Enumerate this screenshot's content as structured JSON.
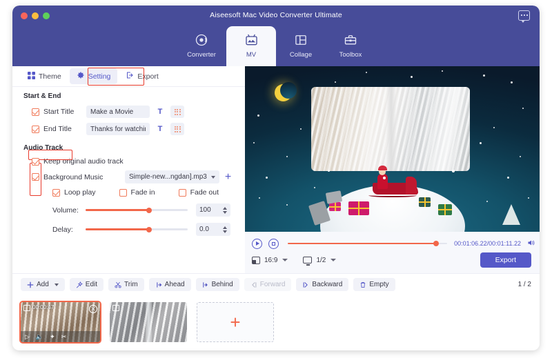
{
  "window": {
    "title": "Aiseesoft Mac Video Converter Ultimate",
    "chat_icon": "chat-bubble-icon",
    "traffic_lights": [
      "close",
      "minimize",
      "maximize"
    ]
  },
  "nav": {
    "tabs": [
      {
        "label": "Converter",
        "icon": "converter-icon",
        "active": false
      },
      {
        "label": "MV",
        "icon": "mv-icon",
        "active": true
      },
      {
        "label": "Collage",
        "icon": "collage-icon",
        "active": false
      },
      {
        "label": "Toolbox",
        "icon": "toolbox-icon",
        "active": false
      }
    ]
  },
  "left_panel": {
    "subtabs": [
      {
        "label": "Theme",
        "icon": "grid-icon",
        "active": false
      },
      {
        "label": "Setting",
        "icon": "gear-icon",
        "active": true
      },
      {
        "label": "Export",
        "icon": "export-icon",
        "active": false
      }
    ],
    "start_end": {
      "section_title": "Start & End",
      "start_title": {
        "label": "Start Title",
        "value": "Make a Movie",
        "checked": true,
        "text_button": "T",
        "style_button": "dots-grid-icon"
      },
      "end_title": {
        "label": "End Title",
        "value": "Thanks for watching",
        "checked": true,
        "text_button": "T",
        "style_button": "dots-grid-icon"
      }
    },
    "audio_track": {
      "section_title": "Audio Track",
      "keep_original": {
        "label": "Keep original audio track",
        "checked": true
      },
      "background_music": {
        "label": "Background Music",
        "checked": true
      },
      "music_file": "Simple-new...ngdan].mp3",
      "add_music_button": "+",
      "options": [
        {
          "label": "Loop play",
          "checked": true
        },
        {
          "label": "Fade in",
          "checked": false
        },
        {
          "label": "Fade out",
          "checked": false
        }
      ],
      "volume": {
        "label": "Volume:",
        "value": "100",
        "percent": 62
      },
      "delay": {
        "label": "Delay:",
        "value": "0.0",
        "percent": 62
      }
    }
  },
  "preview": {
    "scene": "christmas-snowglobe-santa-sleigh",
    "player": {
      "play_button": "play-icon",
      "stop_button": "stop-icon",
      "current_time": "00:01:06.22",
      "total_time": "00:01:11.22",
      "time_display": "00:01:06.22/00:01:11.22",
      "progress_percent": 93,
      "volume_icon": "speaker-icon",
      "aspect_ratio": "16:9",
      "screen_scale": "1/2",
      "export_label": "Export"
    }
  },
  "toolbar": {
    "buttons": [
      {
        "label": "Add",
        "icon": "plus-icon",
        "has_caret": true,
        "disabled": false
      },
      {
        "label": "Edit",
        "icon": "magic-wand-icon",
        "has_caret": false,
        "disabled": false
      },
      {
        "label": "Trim",
        "icon": "scissors-icon",
        "has_caret": false,
        "disabled": false
      },
      {
        "label": "Ahead",
        "icon": "ahead-icon",
        "has_caret": false,
        "disabled": false
      },
      {
        "label": "Behind",
        "icon": "behind-icon",
        "has_caret": false,
        "disabled": false
      },
      {
        "label": "Forward",
        "icon": "forward-icon",
        "has_caret": false,
        "disabled": true
      },
      {
        "label": "Backward",
        "icon": "backward-icon",
        "has_caret": false,
        "disabled": false
      },
      {
        "label": "Empty",
        "icon": "trash-icon",
        "has_caret": false,
        "disabled": false
      }
    ],
    "page_indicator": "1 / 2"
  },
  "timeline": {
    "clips": [
      {
        "duration": "00:00:47",
        "selected": true,
        "film_icon": "film-icon",
        "close_icon": "close-icon",
        "actions": [
          "play-icon",
          "volume-icon",
          "effects-icon",
          "trim-icon"
        ]
      },
      {
        "duration": "",
        "selected": false,
        "film_icon": "film-icon"
      }
    ],
    "add_slot_label": "+"
  },
  "colors": {
    "header_purple": "#474C99",
    "accent_indigo": "#5558C8",
    "accent_orange": "#F2674A",
    "checkbox_orange": "#F07A5A",
    "highlight_red": "#E8392B",
    "panel_bg": "#F7F8FC"
  }
}
